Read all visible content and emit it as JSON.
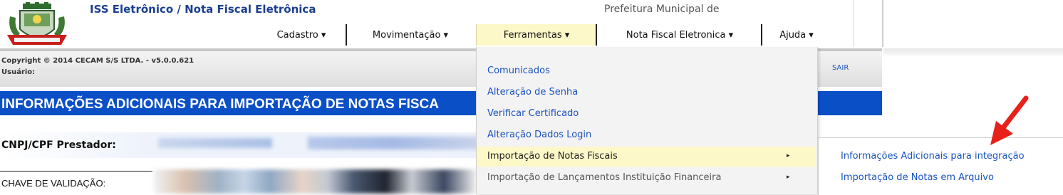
{
  "header": {
    "app_title": "ISS Eletrônico / Nota Fiscal Eletrônica",
    "municipality": "Prefeitura Municipal de"
  },
  "menu": [
    {
      "label": "Cadastro ▾"
    },
    {
      "label": "Movimentação ▾"
    },
    {
      "label": "Ferramentas ▾"
    },
    {
      "label": "Nota Fiscal Eletronica ▾"
    },
    {
      "label": "Ajuda ▾"
    }
  ],
  "infobar": {
    "copyright": "Copyright © 2014 CECAM S/S LTDA. - v5.0.0.621",
    "user_label": "Usuário:",
    "logout": "SAIR"
  },
  "page": {
    "title": "INFORMAÇÕES ADICIONAIS PARA IMPORTAÇÃO DE NOTAS FISCA",
    "cnpj_label": "CNPJ/CPF Prestador:",
    "chave_label": "CHAVE DE VALIDAÇÃO:"
  },
  "dropdown": {
    "items": [
      {
        "label": "Comunicados"
      },
      {
        "label": "Alteração de Senha"
      },
      {
        "label": "Verificar Certificado"
      },
      {
        "label": "Alteração Dados Login"
      },
      {
        "label": "Importação de Notas Fiscais",
        "arrow": "▸"
      },
      {
        "label": "Importação de Lançamentos Instituição Financeira",
        "arrow": "▸"
      }
    ]
  },
  "submenu": {
    "items": [
      {
        "label": "Informações Adicionais para integração"
      },
      {
        "label": "Importação de Notas em Arquivo"
      }
    ]
  },
  "colors": {
    "link": "#1a53c0",
    "title_bar": "#0b4fc7",
    "highlight": "#fdf8c8",
    "annotation_arrow": "#e8201a"
  }
}
